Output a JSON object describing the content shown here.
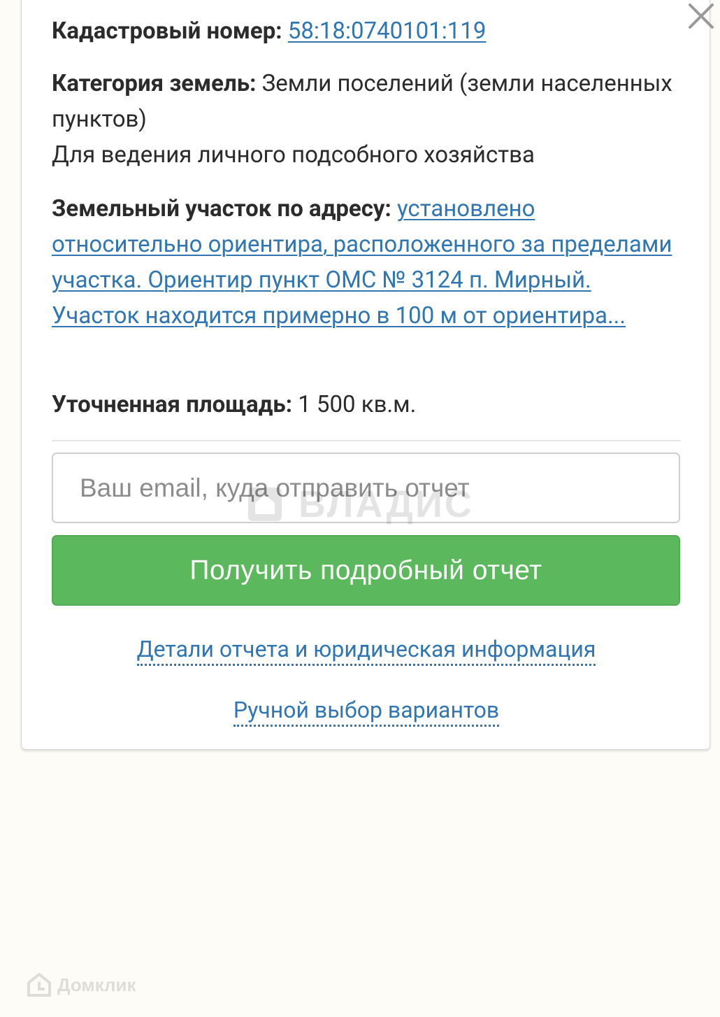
{
  "popup": {
    "cadastral": {
      "label": "Кадастровый номер:",
      "value": "58:18:0740101:119"
    },
    "category": {
      "label": "Категория земель:",
      "value": "Земли поселений (земли населенных пунктов)",
      "purpose": "Для ведения личного подсобного хозяйства"
    },
    "address": {
      "label": "Земельный участок по адресу:",
      "value": "установлено относительно ориентира, расположенного за пределами участка. Ориентир пункт ОМС № 3124 п. Мирный. Участок находится примерно в 100 м от ориентира..."
    },
    "area": {
      "label": "Уточненная площадь:",
      "value": "1 500 кв.м."
    },
    "email_placeholder": "Ваш email, куда отправить отчет",
    "submit_label": "Получить подробный отчет",
    "details_link": "Детали отчета и юридическая информация",
    "manual_link": "Ручной выбор вариантов"
  },
  "watermark": {
    "text": "ВЛАДИС"
  },
  "footer_logo": {
    "text": "Домклик"
  },
  "colors": {
    "link": "#2f76b3",
    "button": "#5cb85c",
    "text": "#2b2b2b"
  }
}
